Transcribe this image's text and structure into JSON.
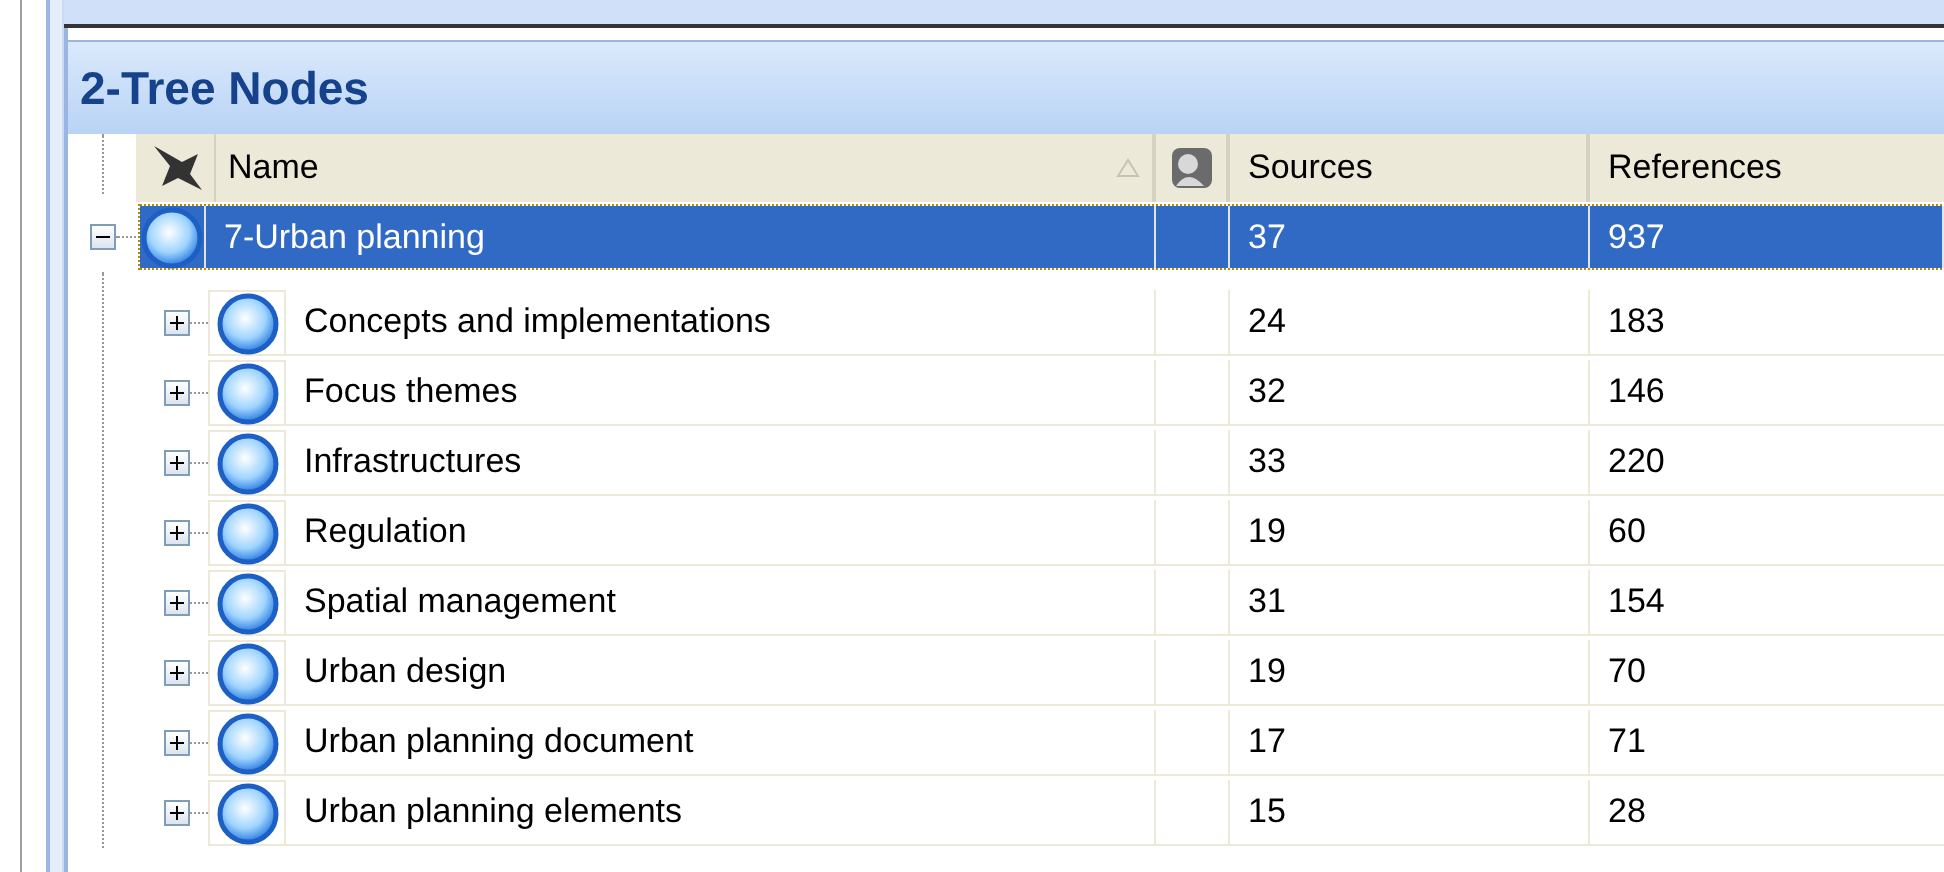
{
  "panel": {
    "title": "2-Tree Nodes"
  },
  "columns": [
    {
      "label": "Name",
      "sorted": true
    },
    {
      "label": "Sources"
    },
    {
      "label": "References"
    }
  ],
  "tree": [
    {
      "name": "7-Urban planning",
      "sources": "37",
      "references": "937",
      "selected": true,
      "expanded": true,
      "children": [
        {
          "name": "Concepts and implementations",
          "sources": "24",
          "references": "183",
          "selected": false,
          "expanded": false
        },
        {
          "name": "Focus themes",
          "sources": "32",
          "references": "146",
          "selected": false,
          "expanded": false
        },
        {
          "name": "Infrastructures",
          "sources": "33",
          "references": "220",
          "selected": false,
          "expanded": false
        },
        {
          "name": "Regulation",
          "sources": "19",
          "references": "60",
          "selected": false,
          "expanded": false
        },
        {
          "name": "Spatial management",
          "sources": "31",
          "references": "154",
          "selected": false,
          "expanded": false
        },
        {
          "name": "Urban design",
          "sources": "19",
          "references": "70",
          "selected": false,
          "expanded": false
        },
        {
          "name": "Urban planning document",
          "sources": "17",
          "references": "71",
          "selected": false,
          "expanded": false
        },
        {
          "name": "Urban planning elements",
          "sources": "15",
          "references": "28",
          "selected": false,
          "expanded": false
        }
      ]
    }
  ]
}
